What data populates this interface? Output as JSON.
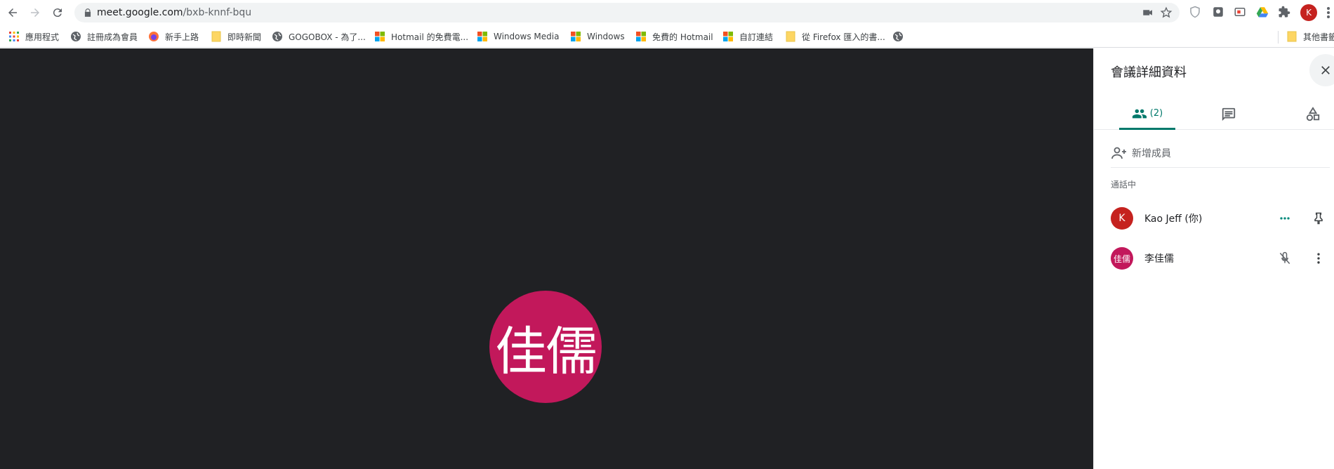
{
  "browser": {
    "url_host": "meet.google.com",
    "url_path": "/bxb-knnf-bqu",
    "profile_initial": "K",
    "bookmarks": [
      {
        "label": "應用程式",
        "icon": "apps-grid-icon"
      },
      {
        "label": "註冊成為會員",
        "icon": "globe-icon"
      },
      {
        "label": "新手上路",
        "icon": "firefox-icon"
      },
      {
        "label": "即時新聞",
        "icon": "folder-icon"
      },
      {
        "label": "GOGOBOX - 為了...",
        "icon": "globe-icon"
      },
      {
        "label": "Hotmail 的免費電...",
        "icon": "windows-icon"
      },
      {
        "label": "Windows Media",
        "icon": "windows-icon"
      },
      {
        "label": "Windows",
        "icon": "windows-icon"
      },
      {
        "label": "免費的 Hotmail",
        "icon": "windows-icon"
      },
      {
        "label": "自訂連結",
        "icon": "windows-icon"
      },
      {
        "label": "從 Firefox 匯入的書...",
        "icon": "folder-icon"
      },
      {
        "label": "",
        "icon": "globe-icon"
      }
    ],
    "other_bookmarks": "其他書籤"
  },
  "stage": {
    "avatar_text": "佳儒",
    "avatar_color": "#c2185b"
  },
  "panel": {
    "title": "會議詳細資料",
    "people_count": "(2)",
    "add_people": "新增成員",
    "section_in_call": "通話中",
    "participants": [
      {
        "initial": "K",
        "name": "Kao Jeff (你)",
        "color": "#c5221f"
      },
      {
        "initial": "佳儒",
        "name": "李佳儒",
        "color": "#c2185b"
      }
    ],
    "accent": "#00796b"
  }
}
